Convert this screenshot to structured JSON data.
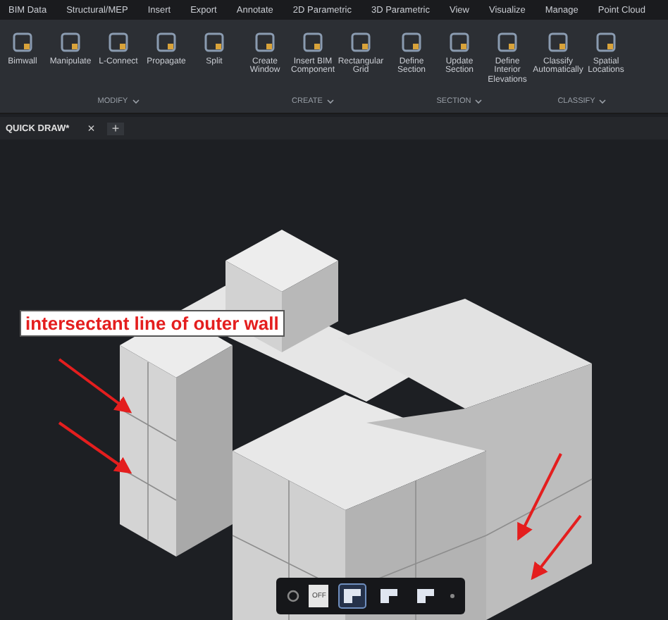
{
  "menu_tabs": [
    "BIM Data",
    "Structural/MEP",
    "Insert",
    "Export",
    "Annotate",
    "2D Parametric",
    "3D Parametric",
    "View",
    "Visualize",
    "Manage",
    "Point Cloud"
  ],
  "ribbon": {
    "groups": [
      {
        "label": "MODIFY",
        "buttons": [
          "Bimwall",
          "Manipulate",
          "L-Connect",
          "Propagate",
          "Split"
        ]
      },
      {
        "label": "CREATE",
        "buttons": [
          "Create Window",
          "Insert BIM Component",
          "Rectangular Grid"
        ]
      },
      {
        "label": "SECTION",
        "buttons": [
          "Define Section",
          "Update Section",
          "Define Interior Elevations"
        ]
      },
      {
        "label": "CLASSIFY",
        "buttons": [
          "Classify Automatically",
          "Spatial Locations"
        ]
      }
    ]
  },
  "document_tab": {
    "title": "QUICK DRAW*",
    "close": "×",
    "add": "+"
  },
  "annotation": {
    "text": "intersectant line of outer wall"
  },
  "bottom_toolbar": [
    {
      "kind": "settings"
    },
    {
      "kind": "toggle",
      "label": "OFF"
    },
    {
      "kind": "corner",
      "selected": true
    },
    {
      "kind": "corner",
      "selected": false
    },
    {
      "kind": "corner",
      "selected": false
    },
    {
      "kind": "dot"
    }
  ]
}
